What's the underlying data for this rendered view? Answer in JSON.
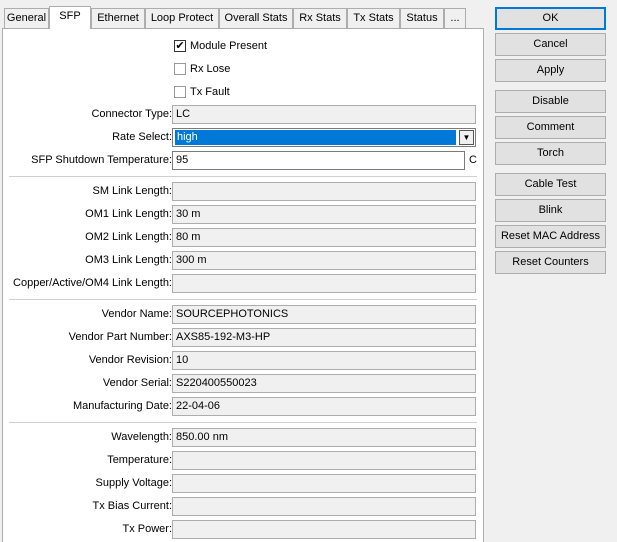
{
  "tabs": [
    "General",
    "SFP",
    "Ethernet",
    "Loop Protect",
    "Overall Stats",
    "Rx Stats",
    "Tx Stats",
    "Status",
    "..."
  ],
  "checkboxes": {
    "module_present": {
      "label": "Module Present",
      "checked": true,
      "mark": "✔"
    },
    "rx_lose": {
      "label": "Rx Lose",
      "checked": false
    },
    "tx_fault": {
      "label": "Tx Fault",
      "checked": false
    }
  },
  "fields": {
    "connector_type": {
      "label": "Connector Type:",
      "value": "LC"
    },
    "rate_select": {
      "label": "Rate Select:",
      "value": "high"
    },
    "shutdown_temp": {
      "label": "SFP Shutdown Temperature:",
      "value": "95",
      "unit": "C"
    },
    "sm_link": {
      "label": "SM Link Length:",
      "value": ""
    },
    "om1_link": {
      "label": "OM1 Link Length:",
      "value": "30 m"
    },
    "om2_link": {
      "label": "OM2 Link Length:",
      "value": "80 m"
    },
    "om3_link": {
      "label": "OM3 Link Length:",
      "value": "300 m"
    },
    "copper_link": {
      "label": "Copper/Active/OM4 Link Length:",
      "value": ""
    },
    "vendor_name": {
      "label": "Vendor Name:",
      "value": "SOURCEPHOTONICS"
    },
    "vendor_part": {
      "label": "Vendor Part Number:",
      "value": "AXS85-192-M3-HP"
    },
    "vendor_rev": {
      "label": "Vendor Revision:",
      "value": "10"
    },
    "vendor_serial": {
      "label": "Vendor Serial:",
      "value": "S220400550023"
    },
    "mfg_date": {
      "label": "Manufacturing Date:",
      "value": "22-04-06"
    },
    "wavelength": {
      "label": "Wavelength:",
      "value": "850.00 nm"
    },
    "temperature": {
      "label": "Temperature:",
      "value": ""
    },
    "supply_voltage": {
      "label": "Supply Voltage:",
      "value": ""
    },
    "tx_bias": {
      "label": "Tx Bias Current:",
      "value": ""
    },
    "tx_power": {
      "label": "Tx Power:",
      "value": ""
    }
  },
  "buttons": {
    "ok": "OK",
    "cancel": "Cancel",
    "apply": "Apply",
    "disable": "Disable",
    "comment": "Comment",
    "torch": "Torch",
    "cable_test": "Cable Test",
    "blink": "Blink",
    "reset_mac": "Reset MAC Address",
    "reset_counters": "Reset Counters"
  }
}
